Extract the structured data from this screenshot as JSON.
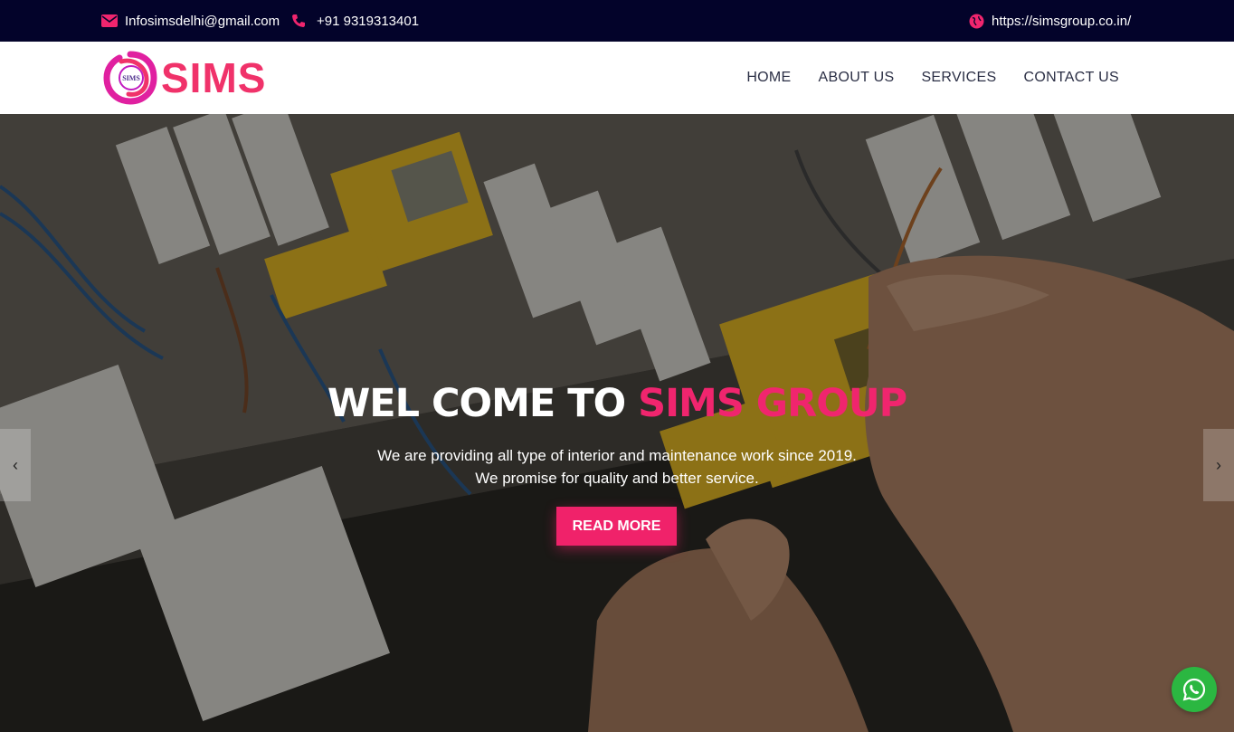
{
  "topbar": {
    "email": "Infosimsdelhi@gmail.com",
    "phone": "+91 9319313401",
    "website": "https://simsgroup.co.in/",
    "icon_color": "#f0256e"
  },
  "header": {
    "logo_text": "SIMS",
    "logo_badge": "SIMS",
    "nav": {
      "home": "HOME",
      "about": "ABOUT US",
      "services": "SERVICES",
      "contact": "CONTACT US"
    }
  },
  "hero": {
    "title_prefix": "WEL COME TO ",
    "title_accent": "SIMS GROUP",
    "subtitle_line1": "We are providing all type of interior and maintenance work since 2019.",
    "subtitle_line2": "We promise for quality and better service.",
    "button_label": "READ MORE",
    "prev_glyph": "‹",
    "next_glyph": "›"
  },
  "icons": {
    "email": "envelope-icon",
    "phone": "phone-icon",
    "website": "globe-icon",
    "whatsapp": "whatsapp-icon"
  },
  "colors": {
    "accent": "#f0256e",
    "topbar_bg": "#03032a",
    "whatsapp": "#2bb741"
  }
}
